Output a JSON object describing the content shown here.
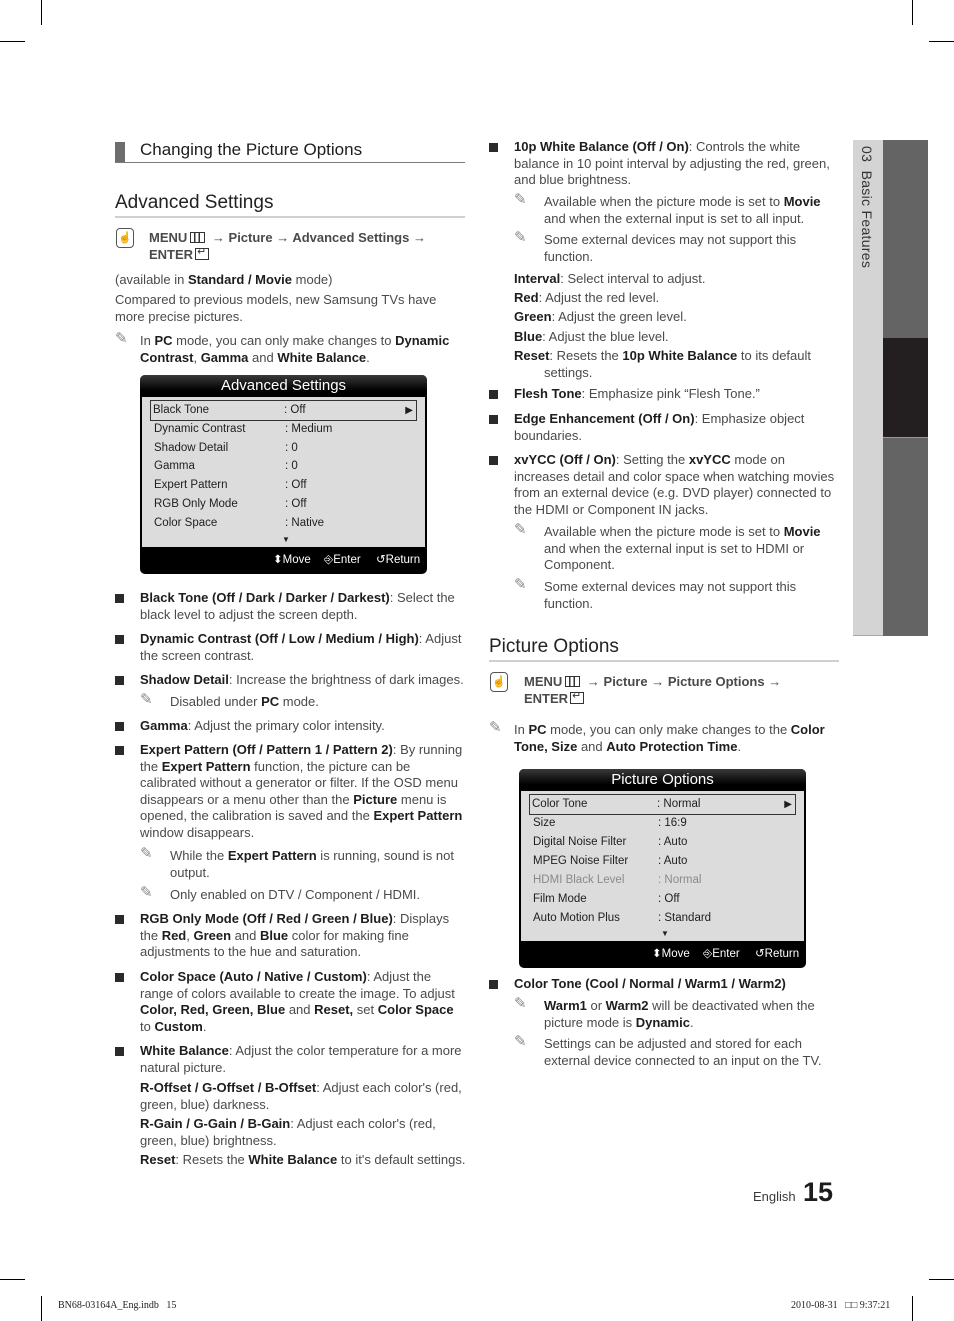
{
  "page": {
    "section_header": "Changing the Picture Options",
    "side_tab": {
      "chapter": "03",
      "label": "Basic Features"
    },
    "footer": {
      "language": "English",
      "page_number": "15"
    },
    "print_slug": {
      "file": "BN68-03164A_Eng.indb   15",
      "timestamp": "2010-08-31   □□ 9:37:21"
    }
  },
  "advanced_settings": {
    "heading": "Advanced Settings",
    "menu_path": {
      "menu": "MENU",
      "path": "→ Picture → Advanced Settings →",
      "enter": "ENTER"
    },
    "availability": {
      "pre": "(available in ",
      "bold": "Standard / Movie",
      "post": " mode)"
    },
    "intro": "Compared to previous models, new Samsung TVs have more precise pictures.",
    "pc_note": {
      "pre": "In ",
      "b1": "PC",
      "mid": " mode, you can only make changes to ",
      "b2": "Dynamic Contrast",
      "c1": ", ",
      "b3": "Gamma",
      "c2": " and ",
      "b4": "White Balance",
      "end": "."
    },
    "osd": {
      "title": "Advanced Settings",
      "rows": [
        {
          "label": "Black Tone",
          "value": ": Off",
          "selected": true
        },
        {
          "label": "Dynamic Contrast",
          "value": ": Medium"
        },
        {
          "label": "Shadow Detail",
          "value": ": 0"
        },
        {
          "label": "Gamma",
          "value": ": 0"
        },
        {
          "label": "Expert Pattern",
          "value": ": Off"
        },
        {
          "label": "RGB Only Mode",
          "value": ": Off"
        },
        {
          "label": "Color Space",
          "value": ": Native"
        }
      ],
      "footer": {
        "move": "Move",
        "enter": "Enter",
        "return": "Return"
      }
    },
    "items": {
      "black_tone": {
        "b": "Black Tone (Off / Dark / Darker / Darkest)",
        "t": ": Select the black level to adjust the screen depth."
      },
      "dynamic_contrast": {
        "b": "Dynamic Contrast (Off / Low / Medium / High)",
        "t": ": Adjust the screen contrast."
      },
      "shadow_detail": {
        "b": "Shadow Detail",
        "t": ": Increase the brightness of dark images.",
        "note_pre": "Disabled under ",
        "note_b": "PC",
        "note_post": " mode."
      },
      "gamma": {
        "b": "Gamma",
        "t": ": Adjust the primary color intensity."
      },
      "expert_pattern": {
        "b": "Expert Pattern (Off / Pattern 1 / Pattern 2)",
        "t1": ": By running the ",
        "b2": "Expert Pattern",
        "t2": " function, the picture can be calibrated without a generator or filter. If the OSD menu disappears or a menu other than the ",
        "b3": "Picture",
        "t3": " menu is opened, the calibration is saved and the ",
        "b4": "Expert Pattern",
        "t4": " window disappears.",
        "note1_pre": "While the ",
        "note1_b": "Expert Pattern",
        "note1_post": " is running, sound is not output.",
        "note2": "Only enabled on DTV / Component / HDMI."
      },
      "rgb_only": {
        "b": "RGB Only Mode (Off / Red / Green / Blue)",
        "t1": ": Displays the ",
        "b2": "Red",
        "c1": ", ",
        "b3": "Green",
        "t2": " and ",
        "b4": "Blue",
        "t3": " color for making fine adjustments to the hue and saturation."
      },
      "color_space": {
        "b": "Color Space (Auto / Native / Custom)",
        "t1": ": Adjust the range of colors available to create the image. To adjust ",
        "b2": "Color, Red, Green, Blue",
        "t2": " and ",
        "b3": "Reset,",
        "t3": " set ",
        "b4": "Color Space",
        "t4": " to ",
        "b5": "Custom",
        "t5": "."
      },
      "white_balance": {
        "b": "White Balance",
        "t": ": Adjust the color temperature for a more natural picture.",
        "offset_b": "R-Offset / G-Offset / B-Offset",
        "offset_t": ": Adjust each color's (red, green, blue) darkness.",
        "gain_b": "R-Gain / G-Gain / B-Gain",
        "gain_t": ": Adjust each color's (red, green, blue) brightness.",
        "reset_b": "Reset",
        "reset_t1": ": Resets the ",
        "reset_b2": "White Balance",
        "reset_t2": " to it's default settings."
      },
      "wb10": {
        "b": "10p White Balance (Off / On)",
        "t": ": Controls the white balance in 10 point interval by adjusting the red, green, and blue brightness.",
        "note1_pre": "Available when the picture mode is set to ",
        "note1_b": "Movie",
        "note1_post": " and when the external input is set to all input.",
        "note2": "Some external devices may not support this function.",
        "interval_b": "Interval",
        "interval_t": ": Select interval to adjust.",
        "red_b": "Red",
        "red_t": ": Adjust the red level.",
        "green_b": "Green",
        "green_t": ": Adjust the green level.",
        "blue_b": "Blue",
        "blue_t": ": Adjust the blue level.",
        "reset_b": "Reset",
        "reset_t1": ": Resets the ",
        "reset_b2": "10p White Balance",
        "reset_t2": " to its default settings."
      },
      "flesh_tone": {
        "b": "Flesh Tone",
        "t": ": Emphasize pink “Flesh Tone.”"
      },
      "edge": {
        "b": "Edge Enhancement (Off / On)",
        "t": ": Emphasize object boundaries."
      },
      "xvycc": {
        "b": "xvYCC (Off / On)",
        "t1": ": Setting the ",
        "b2": "xvYCC",
        "t2": " mode on increases detail and color space when watching movies from an external device (e.g. DVD player) connected to the HDMI or Component IN jacks.",
        "note1_pre": "Available when the picture mode is set to ",
        "note1_b": "Movie",
        "note1_post": " and when the external input is set to HDMI or Component.",
        "note2": "Some external devices may not support this function."
      }
    }
  },
  "picture_options": {
    "heading": "Picture Options",
    "menu_path": {
      "menu": "MENU",
      "path": "→ Picture → Picture Options →",
      "enter": "ENTER"
    },
    "pc_note": {
      "pre": "In ",
      "b1": "PC",
      "mid": " mode, you can only make changes to the ",
      "b2": "Color Tone, Size",
      "c": " and ",
      "b3": "Auto Protection Time",
      "end": "."
    },
    "osd": {
      "title": "Picture Options",
      "rows": [
        {
          "label": "Color Tone",
          "value": ": Normal",
          "selected": true
        },
        {
          "label": "Size",
          "value": ": 16:9"
        },
        {
          "label": "Digital Noise Filter",
          "value": ": Auto"
        },
        {
          "label": "MPEG Noise Filter",
          "value": ": Auto"
        },
        {
          "label": "HDMI Black Level",
          "value": ": Normal",
          "disabled": true
        },
        {
          "label": "Film Mode",
          "value": ": Off"
        },
        {
          "label": "Auto Motion Plus",
          "value": ": Standard"
        }
      ],
      "footer": {
        "move": "Move",
        "enter": "Enter",
        "return": "Return"
      }
    },
    "color_tone": {
      "b": "Color Tone (Cool / Normal / Warm1 / Warm2)",
      "note1_b1": "Warm1",
      "note1_t1": " or ",
      "note1_b2": "Warm2",
      "note1_t2": " will be deactivated when the picture mode is ",
      "note1_b3": "Dynamic",
      "note1_t3": ".",
      "note2": "Settings can be adjusted and stored for each external device connected to an input on the TV."
    }
  },
  "colors": {
    "osd_bg": "#000000",
    "osd_body": "#dcdcdc",
    "side_tab": "#d4d4d4",
    "side_dark": "#231f20",
    "side_mid": "#646464"
  }
}
